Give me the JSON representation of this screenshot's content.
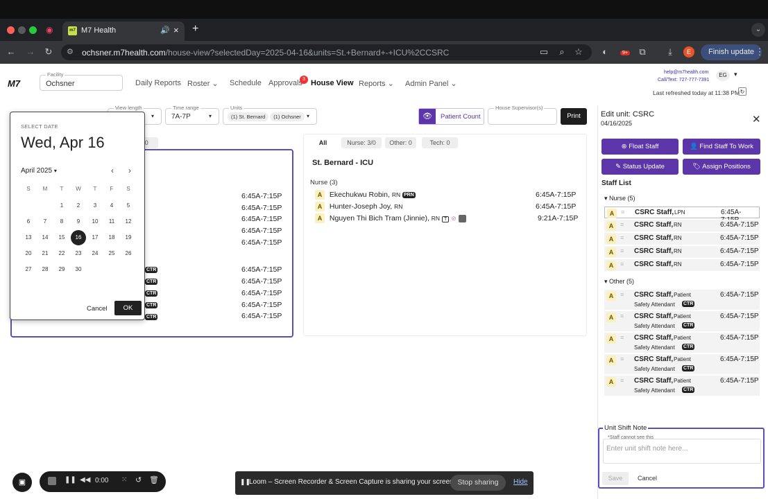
{
  "browser": {
    "tab_title": "M7 Health",
    "tab_logo": "m7",
    "url_host": "ochsner.m7health.com",
    "url_path": "/house-view?selectedDay=2025-04-16&units=St.+Bernard+-+ICU%2CCSRC",
    "profile_initial": "E",
    "ext_badge": "9+",
    "finish_update": "Finish update"
  },
  "header": {
    "logo": "M7",
    "facility_label": "Facility",
    "facility_value": "Ochsner",
    "nav": [
      "Daily Reports",
      "Roster",
      "Schedule",
      "Approvals",
      "House View",
      "Reports",
      "Admin Panel"
    ],
    "approvals_badge": "3",
    "help_email": "help@m7health.com",
    "call_text": "Call/Text: 727-777-7391",
    "user_initials": "EG",
    "last_refreshed": "Last refreshed today at 11:38 PM"
  },
  "filters": {
    "view_length_label": "View length",
    "time_range_label": "Time range",
    "time_range_value": "7A-7P",
    "units_label": "Units",
    "units_chips": [
      "(1) St. Bernard",
      "(1) Ochsner"
    ],
    "patient_count": "Patient Count",
    "house_supervisor_label": "House Supervisor(s)",
    "print": "Print"
  },
  "left_card": {
    "tab_partial": "ch: 0",
    "times_top": [
      "6:45A-7:15P",
      "6:45A-7:15P",
      "6:45A-7:15P",
      "6:45A-7:15P",
      "6:45A-7:15P"
    ],
    "times_bottom": [
      "6:45A-7:15P",
      "6:45A-7:15P",
      "6:45A-7:15P",
      "6:45A-7:15P",
      "6:45A-7:15P"
    ],
    "ctr_tag": "CTR"
  },
  "date_picker": {
    "select_label": "SELECT DATE",
    "selected_date": "Wed, Apr 16",
    "month": "April 2025",
    "weekdays": [
      "S",
      "M",
      "T",
      "W",
      "T",
      "F",
      "S"
    ],
    "weeks": [
      [
        "",
        "",
        "1",
        "2",
        "3",
        "4",
        "5"
      ],
      [
        "6",
        "7",
        "8",
        "9",
        "10",
        "11",
        "12"
      ],
      [
        "13",
        "14",
        "15",
        "16",
        "17",
        "18",
        "19"
      ],
      [
        "20",
        "21",
        "22",
        "23",
        "24",
        "25",
        "26"
      ],
      [
        "27",
        "28",
        "29",
        "30",
        "",
        "",
        ""
      ]
    ],
    "selected_day": "16",
    "cancel": "Cancel",
    "ok": "OK"
  },
  "middle_card": {
    "tabs": [
      "All",
      "Nurse: 3/0",
      "Other: 0",
      "Tech: 0"
    ],
    "unit_title": "St. Bernard - ICU",
    "group_label": "Nurse (3)",
    "staff": [
      {
        "badge": "A",
        "name": "Ekechukwu Robin,",
        "role": "RN",
        "tag": "PRN",
        "time": "6:45A-7:15P"
      },
      {
        "badge": "A",
        "name": "Hunter-Joseph Joy,",
        "role": "RN",
        "tag": "",
        "time": "6:45A-7:15P"
      },
      {
        "badge": "A",
        "name": "Nguyen Thi Bich Tram (Jinnie),",
        "role": "RN",
        "tag": "T",
        "time": "9:21A-7:15P"
      }
    ]
  },
  "right_panel": {
    "title": "Edit unit: CSRC",
    "date": "04/16/2025",
    "buttons": [
      "Float Staff",
      "Find Staff To Work",
      "Status Update",
      "Assign Positions"
    ],
    "staff_list_label": "Staff List",
    "nurse_group": "Nurse (5)",
    "nurses": [
      {
        "badge": "A",
        "name": "CSRC Staff,",
        "role": "LPN",
        "time": "6:45A-7:15P"
      },
      {
        "badge": "A",
        "name": "CSRC Staff,",
        "role": "RN",
        "time": "6:45A-7:15P"
      },
      {
        "badge": "A",
        "name": "CSRC Staff,",
        "role": "RN",
        "time": "6:45A-7:15P"
      },
      {
        "badge": "A",
        "name": "CSRC Staff,",
        "role": "RN",
        "time": "6:45A-7:15P"
      },
      {
        "badge": "A",
        "name": "CSRC Staff,",
        "role": "RN",
        "time": "6:45A-7:15P"
      }
    ],
    "other_group": "Other (5)",
    "others": [
      {
        "badge": "A",
        "name": "CSRC Staff,",
        "role": "Patient",
        "role2": "Safety Attendant",
        "tag": "CTR",
        "time": "6:45A-7:15P"
      },
      {
        "badge": "A",
        "name": "CSRC Staff,",
        "role": "Patient",
        "role2": "Safety Attendant",
        "tag": "CTR",
        "time": "6:45A-7:15P"
      },
      {
        "badge": "A",
        "name": "CSRC Staff,",
        "role": "Patient",
        "role2": "Safety Attendant",
        "tag": "CTR",
        "time": "6:45A-7:15P"
      },
      {
        "badge": "A",
        "name": "CSRC Staff,",
        "role": "Patient",
        "role2": "Safety Attendant",
        "tag": "CTR",
        "time": "6:45A-7:15P"
      },
      {
        "badge": "A",
        "name": "CSRC Staff,",
        "role": "Patient",
        "role2": "Safety Attendant",
        "tag": "CTR",
        "time": "6:45A-7:15P"
      }
    ],
    "shift_note_label": "Unit Shift Note",
    "shift_note_hint": "*Staff cannot see this",
    "shift_note_placeholder": "Enter unit shift note here...",
    "save": "Save",
    "cancel": "Cancel"
  },
  "loom": {
    "timer": "0:00",
    "share_text": "Loom – Screen Recorder & Screen Capture is sharing your screen.",
    "stop_sharing": "Stop sharing",
    "hide": "Hide"
  },
  "colors": {
    "accent": "#5c35a8",
    "badge_bg": "#fbf0c0",
    "chrome_dark": "#202124"
  }
}
